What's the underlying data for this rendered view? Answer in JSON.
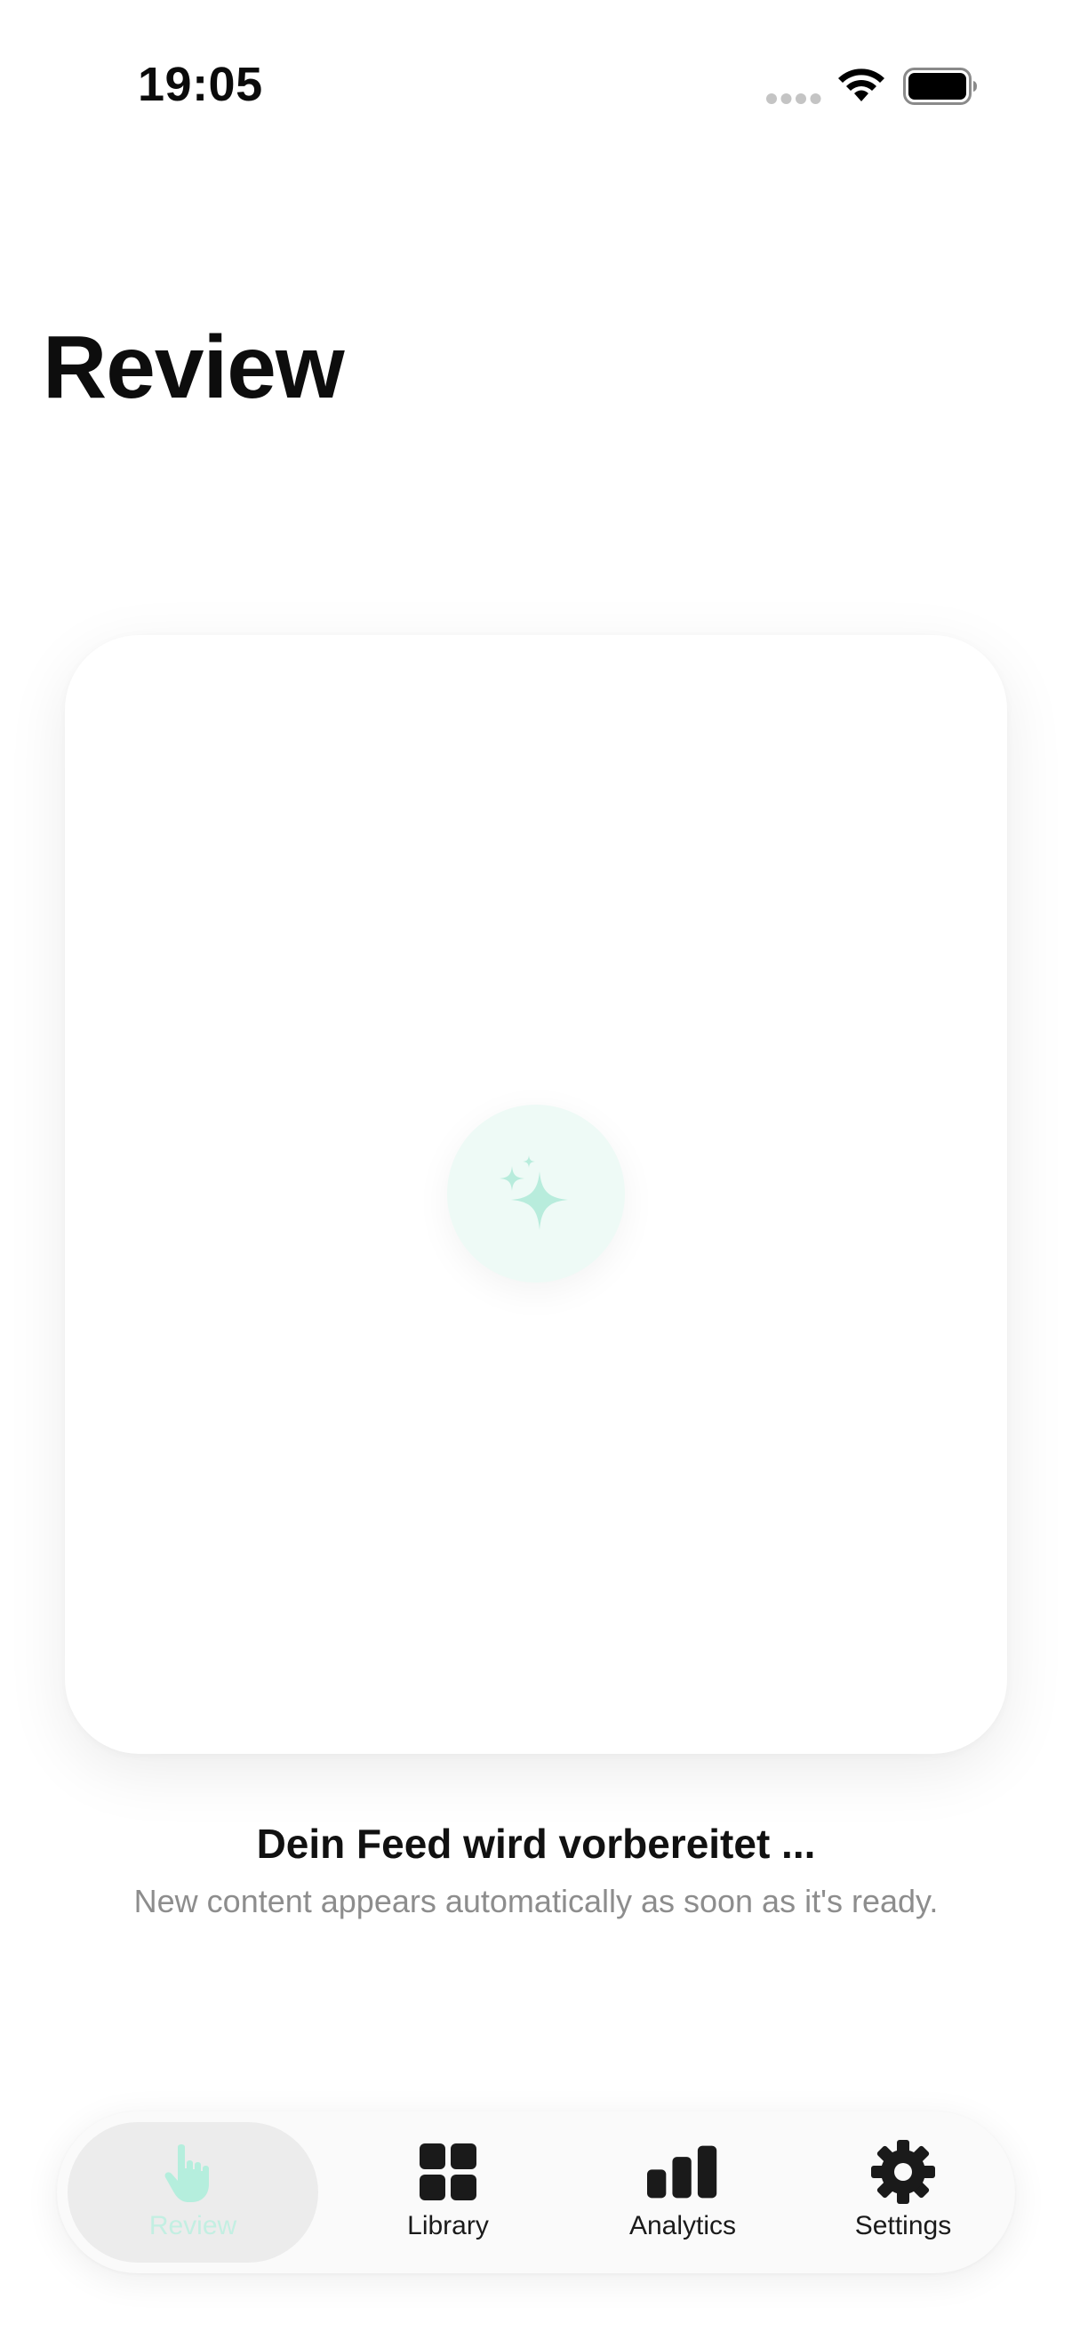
{
  "status_bar": {
    "time": "19:05"
  },
  "page": {
    "title": "Review"
  },
  "feed": {
    "title": "Dein Feed wird vorbereitet ...",
    "subtitle": "New content appears automatically as soon as it's ready."
  },
  "tabs": [
    {
      "label": "Review",
      "icon": "hand-tap-icon",
      "active": true
    },
    {
      "label": "Library",
      "icon": "grid-icon",
      "active": false
    },
    {
      "label": "Analytics",
      "icon": "bar-chart-icon",
      "active": false
    },
    {
      "label": "Settings",
      "icon": "gear-icon",
      "active": false
    }
  ],
  "colors": {
    "accent": "#b5eedd",
    "badge_bg": "#eefaf6",
    "subtitle": "#8d8d8d"
  }
}
